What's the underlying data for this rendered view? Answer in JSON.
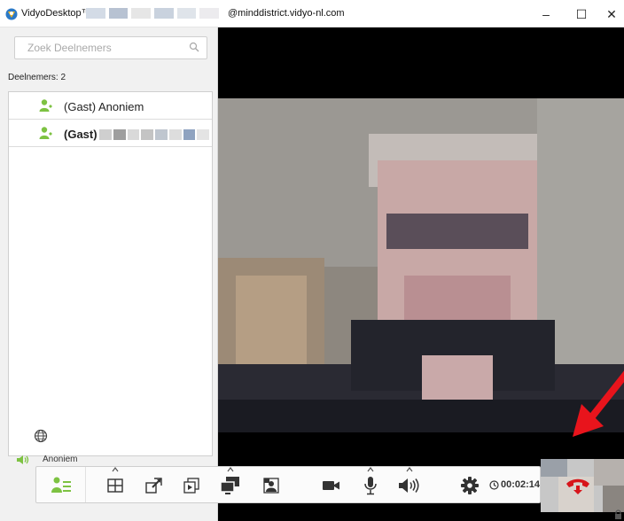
{
  "window": {
    "title_prefix": "VidyoDesktop™ -",
    "title_suffix": "@minddistrict.vidyo-nl.com",
    "minimize_glyph": "–",
    "maximize_glyph": "☐",
    "close_glyph": "✕"
  },
  "sidebar": {
    "search": {
      "placeholder": "Zoek Deelnemers",
      "value": ""
    },
    "count_label": "Deelnemers: 2",
    "participants": [
      {
        "name": "(Gast) Anoniem",
        "icon": "user-icon",
        "bold": false
      },
      {
        "name": "(Gast)",
        "icon": "user-icon",
        "bold": true
      }
    ],
    "footer_icon": "globe-icon",
    "active_speaker": {
      "icon": "speaker-icon",
      "name": "Anoniem"
    }
  },
  "toolbar": {
    "buttons": [
      {
        "name": "participants",
        "icon": "participant-list-icon"
      },
      {
        "name": "layout",
        "icon": "grid-layout-icon"
      },
      {
        "name": "fullscreen",
        "icon": "fullscreen-icon"
      },
      {
        "name": "share",
        "icon": "share-content-icon"
      },
      {
        "name": "preview",
        "icon": "self-view-icon"
      },
      {
        "name": "pip",
        "icon": "pip-icon"
      },
      {
        "name": "camera",
        "icon": "camera-icon"
      },
      {
        "name": "microphone",
        "icon": "microphone-icon"
      },
      {
        "name": "speaker",
        "icon": "speaker-volume-icon"
      },
      {
        "name": "settings",
        "icon": "gear-icon"
      },
      {
        "name": "hangup",
        "icon": "hang-up-icon"
      }
    ],
    "timer": "00:02:14"
  },
  "colors": {
    "accent_green": "#7dc242",
    "hangup_red": "#d7151b",
    "video_bg": "#000000",
    "sidebar_bg": "#f1f1f1",
    "arrow_red": "#e8141c"
  }
}
